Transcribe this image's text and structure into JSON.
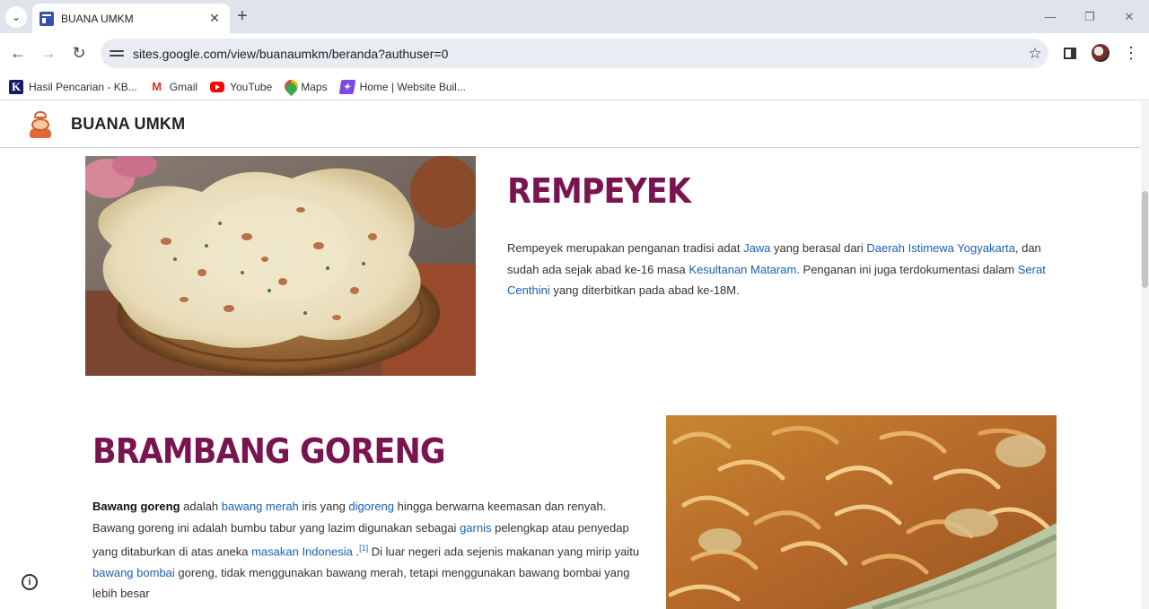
{
  "browser": {
    "tab_title": "BUANA UMKM",
    "tab_menu_icon": "chevron-down-icon",
    "url": "sites.google.com/view/buanaumkm/beranda?authuser=0",
    "bookmarks": [
      {
        "label": "Hasil Pencarian - KB...",
        "icon": "kbbi-icon"
      },
      {
        "label": "Gmail",
        "icon": "gmail-icon"
      },
      {
        "label": "YouTube",
        "icon": "youtube-icon"
      },
      {
        "label": "Maps",
        "icon": "maps-icon"
      },
      {
        "label": "Home | Website Buil...",
        "icon": "website-builder-icon"
      }
    ]
  },
  "site": {
    "name": "BUANA UMKM"
  },
  "rempeyek": {
    "title": "REMPEYEK",
    "text_1": "Rempeyek merupakan penganan tradisi adat ",
    "link_jawa": "Jawa",
    "text_2": " yang berasal dari ",
    "link_diy": "Daerah Istimewa Yogyakarta",
    "text_3": ", dan sudah ada sejak abad ke-16 masa ",
    "link_mataram": "Kesultanan Mataram",
    "text_4": ". Penganan ini juga terdokumentasi dalam ",
    "link_centhini": "Serat Centhini",
    "text_5": " yang diterbitkan pada abad ke-18M."
  },
  "brambang": {
    "title": "BRAMBANG GORENG",
    "bold": "Bawang goreng",
    "text_1": " adalah ",
    "link_bawang_merah": "bawang merah",
    "text_2": " iris yang ",
    "link_digoreng": "digoreng",
    "text_3": " hingga berwarna keemasan dan renyah. Bawang goreng ini adalah bumbu tabur yang lazim digunakan sebagai ",
    "link_garnis": "garnis",
    "text_4": " pelengkap atau penyedap yang ditaburkan di atas aneka ",
    "link_masakan": "masakan Indonesia",
    "text_5": " .",
    "footnote": "[1]",
    "text_6": " Di luar negeri ada sejenis makanan yang mirip yaitu ",
    "link_bombai": "bawang bombai",
    "text_7": " goreng, tidak menggunakan bawang merah, tetapi menggunakan bawang bombai yang lebih besar"
  }
}
